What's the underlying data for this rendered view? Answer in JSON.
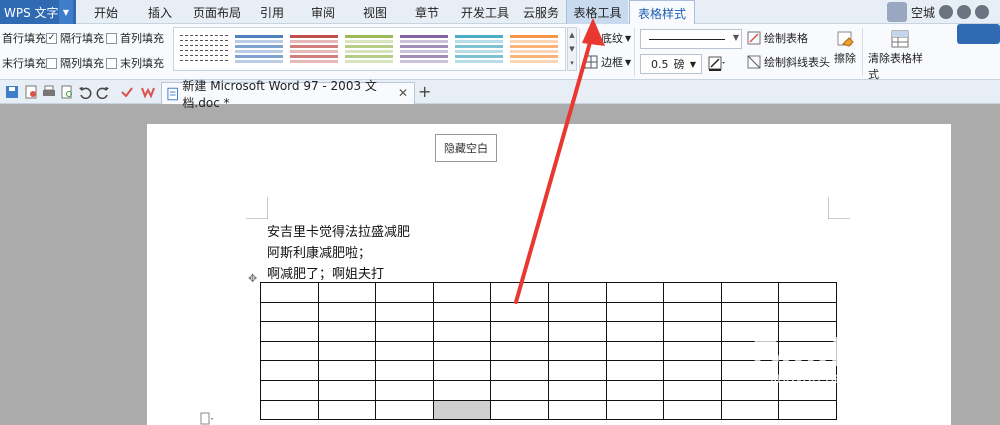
{
  "app": {
    "name": "WPS 文字",
    "user": "空城"
  },
  "menu": {
    "tabs": [
      {
        "label": "开始"
      },
      {
        "label": "插入"
      },
      {
        "label": "页面布局"
      },
      {
        "label": "引用"
      },
      {
        "label": "审阅"
      },
      {
        "label": "视图"
      },
      {
        "label": "章节"
      },
      {
        "label": "开发工具"
      },
      {
        "label": "云服务"
      },
      {
        "label": "表格工具"
      },
      {
        "label": "表格样式"
      }
    ],
    "active": "表格样式"
  },
  "ribbon": {
    "options": [
      {
        "label": "首行填充",
        "checked": false
      },
      {
        "label": "隔行填充",
        "checked": true
      },
      {
        "label": "首列填充",
        "checked": false
      },
      {
        "label": "末行填充",
        "checked": false
      },
      {
        "label": "隔列填充",
        "checked": false
      },
      {
        "label": "末列填充",
        "checked": false
      }
    ],
    "shading": "底纹",
    "borders": "边框",
    "line_width": "0.5",
    "line_width_unit": "磅",
    "draw_table": "绘制表格",
    "draw_diagonal": "绘制斜线表头",
    "eraser": "擦除",
    "clear_style": "清除表格样式",
    "style_colors": [
      "#555555",
      "#4f81bd",
      "#c0504d",
      "#9bbb59",
      "#8064a2",
      "#4bacc6",
      "#f79646"
    ]
  },
  "document": {
    "tab_title": "新建 Microsoft Word 97 - 2003 文档.doc *",
    "hide_blank": "隐藏空白",
    "lines": [
      "安吉里卡觉得法拉盛减肥",
      "阿斯利康减肥啦；",
      "啊减肥了；啊姐夫打"
    ]
  },
  "watermark": {
    "logo": "Baidu经验",
    "url": "jingyan.baidu.com"
  },
  "colors": {
    "accent": "#2f6ab3",
    "arrow": "#e8382f"
  }
}
